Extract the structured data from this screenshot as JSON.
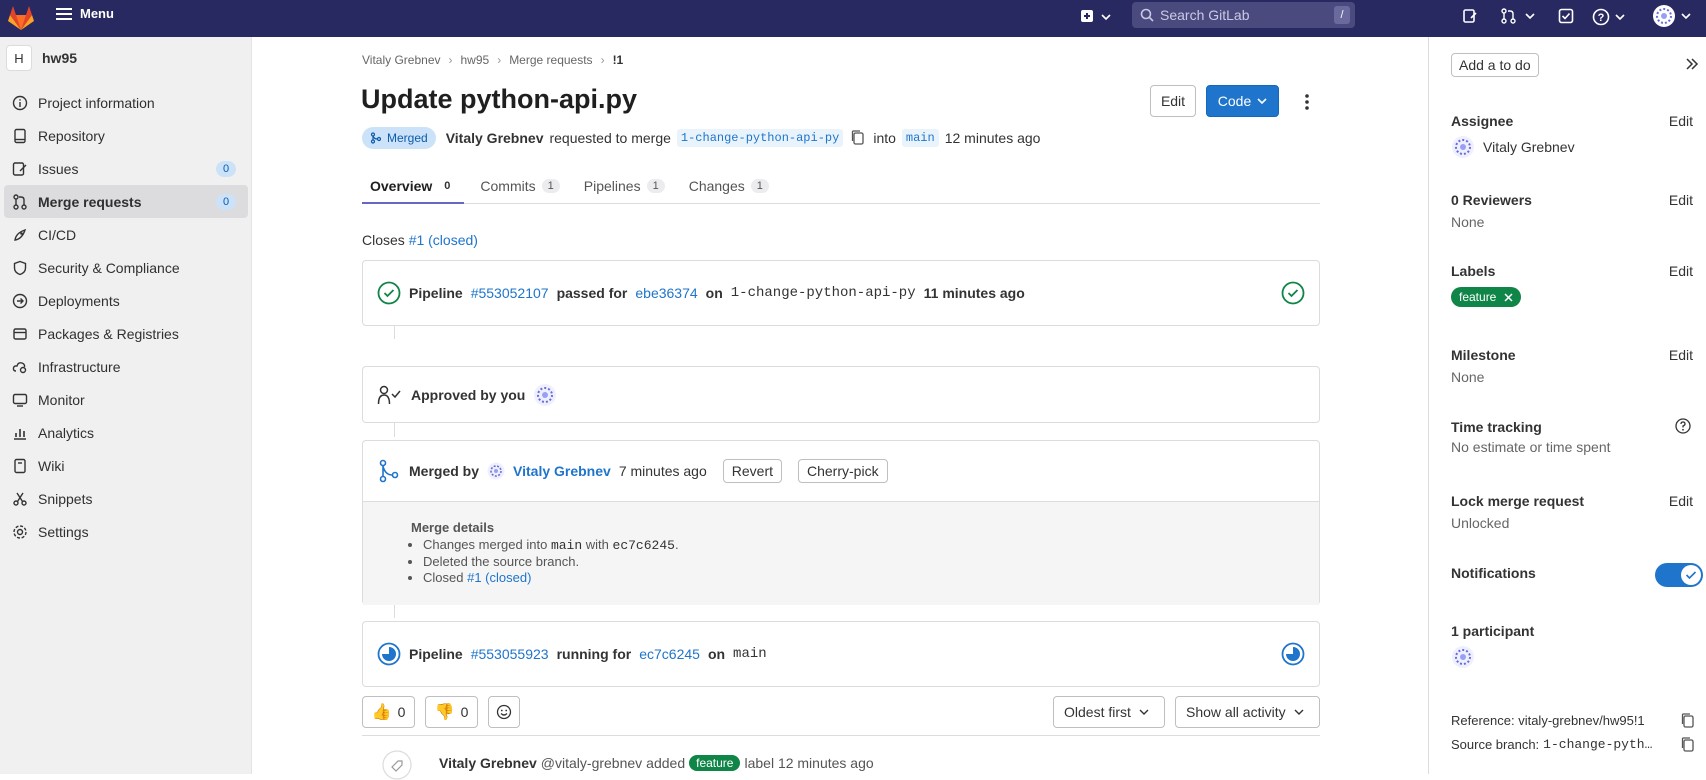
{
  "topbar": {
    "menu_label": "Menu",
    "search_placeholder": "Search GitLab",
    "search_shortcut": "/"
  },
  "sidebar": {
    "project_initial": "H",
    "project_name": "hw95",
    "items": [
      {
        "label": "Project information",
        "icon": "info-icon"
      },
      {
        "label": "Repository",
        "icon": "repository-icon"
      },
      {
        "label": "Issues",
        "icon": "issues-icon",
        "count": "0"
      },
      {
        "label": "Merge requests",
        "icon": "merge-request-icon",
        "count": "0",
        "active": true
      },
      {
        "label": "CI/CD",
        "icon": "rocket-icon"
      },
      {
        "label": "Security & Compliance",
        "icon": "shield-icon"
      },
      {
        "label": "Deployments",
        "icon": "deployments-icon"
      },
      {
        "label": "Packages & Registries",
        "icon": "package-icon"
      },
      {
        "label": "Infrastructure",
        "icon": "cloud-gear-icon"
      },
      {
        "label": "Monitor",
        "icon": "monitor-icon"
      },
      {
        "label": "Analytics",
        "icon": "chart-icon"
      },
      {
        "label": "Wiki",
        "icon": "book-icon"
      },
      {
        "label": "Snippets",
        "icon": "snippet-icon"
      },
      {
        "label": "Settings",
        "icon": "gear-icon"
      }
    ]
  },
  "breadcrumb": [
    "Vitaly Grebnev",
    "hw95",
    "Merge requests",
    "!1"
  ],
  "mr": {
    "title": "Update python-api.py",
    "edit_label": "Edit",
    "code_label": "Code",
    "status": "Merged",
    "author": "Vitaly Grebnev",
    "requested_text": "requested to merge",
    "source_branch": "1-change-python-api-py",
    "into_text": "into",
    "target_branch": "main",
    "time_ago": "12 minutes ago"
  },
  "tabs": [
    {
      "label": "Overview",
      "count": "0"
    },
    {
      "label": "Commits",
      "count": "1"
    },
    {
      "label": "Pipelines",
      "count": "1"
    },
    {
      "label": "Changes",
      "count": "1"
    }
  ],
  "closes": {
    "prefix": "Closes",
    "link": "#1 (closed)"
  },
  "pipeline1": {
    "label": "Pipeline",
    "id": "#553052107",
    "status": "passed for",
    "commit": "ebe36374",
    "on": "on",
    "branch": "1-change-python-api-py",
    "time": "11 minutes ago"
  },
  "approval": {
    "text": "Approved by you"
  },
  "merged": {
    "prefix": "Merged by",
    "user": "Vitaly Grebnev",
    "time": "7 minutes ago",
    "revert_label": "Revert",
    "cherry_pick_label": "Cherry-pick",
    "details_title": "Merge details",
    "detail1_prefix": "Changes merged into",
    "detail1_branch": "main",
    "detail1_with": "with",
    "detail1_commit": "ec7c6245",
    "detail1_suffix": ".",
    "detail2": "Deleted the source branch.",
    "detail3_prefix": "Closed",
    "detail3_link": "#1 (closed)"
  },
  "pipeline2": {
    "label": "Pipeline",
    "id": "#553055923",
    "status": "running for",
    "commit": "ec7c6245",
    "on": "on",
    "branch": "main"
  },
  "reactions": {
    "thumbs_up": "0",
    "thumbs_down": "0"
  },
  "sort": {
    "order": "Oldest first",
    "filter": "Show all activity"
  },
  "activity": {
    "user": "Vitaly Grebnev",
    "handle": "@vitaly-grebnev",
    "added": "added",
    "label": "feature",
    "suffix": "label 12 minutes ago"
  },
  "right_sidebar": {
    "todo_label": "Add a to do",
    "edit_label": "Edit",
    "assignee_title": "Assignee",
    "assignee_name": "Vitaly Grebnev",
    "reviewers_title": "0 Reviewers",
    "reviewers_value": "None",
    "labels_title": "Labels",
    "label_name": "feature",
    "milestone_title": "Milestone",
    "milestone_value": "None",
    "time_title": "Time tracking",
    "time_value": "No estimate or time spent",
    "lock_title": "Lock merge request",
    "lock_value": "Unlocked",
    "notifications_title": "Notifications",
    "notifications_on": true,
    "participants_title": "1 participant",
    "reference": "Reference: vitaly-grebnev/hw95!1",
    "source_branch_prefix": "Source branch:",
    "source_branch_value": "1-change-pyth…"
  },
  "colors": {
    "topbar": "#292961",
    "accent": "#1f75cb",
    "success": "#108548",
    "merged_badge": "#cbe2f9"
  }
}
